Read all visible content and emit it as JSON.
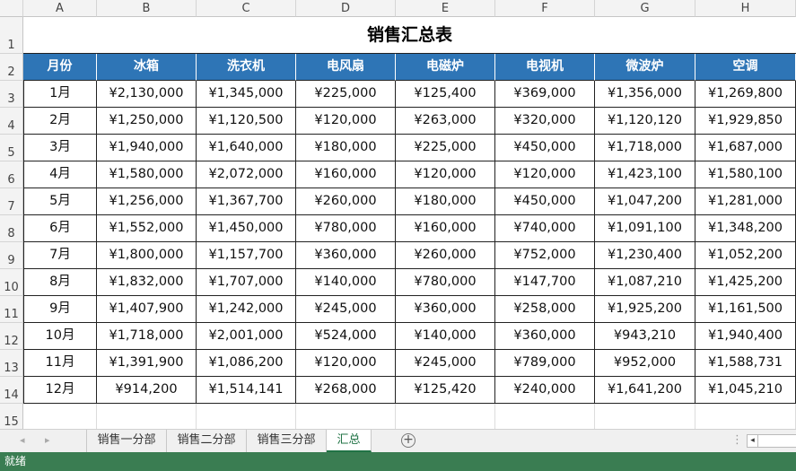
{
  "columns": [
    "A",
    "B",
    "C",
    "D",
    "E",
    "F",
    "G",
    "H"
  ],
  "rows": [
    "1",
    "2",
    "3",
    "4",
    "5",
    "6",
    "7",
    "8",
    "9",
    "10",
    "11",
    "12",
    "13",
    "14",
    "15"
  ],
  "title": "销售汇总表",
  "headers": [
    "月份",
    "冰箱",
    "洗衣机",
    "电风扇",
    "电磁炉",
    "电视机",
    "微波炉",
    "空调"
  ],
  "data": [
    [
      "1月",
      "¥2,130,000",
      "¥1,345,000",
      "¥225,000",
      "¥125,400",
      "¥369,000",
      "¥1,356,000",
      "¥1,269,800"
    ],
    [
      "2月",
      "¥1,250,000",
      "¥1,120,500",
      "¥120,000",
      "¥263,000",
      "¥320,000",
      "¥1,120,120",
      "¥1,929,850"
    ],
    [
      "3月",
      "¥1,940,000",
      "¥1,640,000",
      "¥180,000",
      "¥225,000",
      "¥450,000",
      "¥1,718,000",
      "¥1,687,000"
    ],
    [
      "4月",
      "¥1,580,000",
      "¥2,072,000",
      "¥160,000",
      "¥120,000",
      "¥120,000",
      "¥1,423,100",
      "¥1,580,100"
    ],
    [
      "5月",
      "¥1,256,000",
      "¥1,367,700",
      "¥260,000",
      "¥180,000",
      "¥450,000",
      "¥1,047,200",
      "¥1,281,000"
    ],
    [
      "6月",
      "¥1,552,000",
      "¥1,450,000",
      "¥780,000",
      "¥160,000",
      "¥740,000",
      "¥1,091,100",
      "¥1,348,200"
    ],
    [
      "7月",
      "¥1,800,000",
      "¥1,157,700",
      "¥360,000",
      "¥260,000",
      "¥752,000",
      "¥1,230,400",
      "¥1,052,200"
    ],
    [
      "8月",
      "¥1,832,000",
      "¥1,707,000",
      "¥140,000",
      "¥780,000",
      "¥147,700",
      "¥1,087,210",
      "¥1,425,200"
    ],
    [
      "9月",
      "¥1,407,900",
      "¥1,242,000",
      "¥245,000",
      "¥360,000",
      "¥258,000",
      "¥1,925,200",
      "¥1,161,500"
    ],
    [
      "10月",
      "¥1,718,000",
      "¥2,001,000",
      "¥524,000",
      "¥140,000",
      "¥360,000",
      "¥943,210",
      "¥1,940,400"
    ],
    [
      "11月",
      "¥1,391,900",
      "¥1,086,200",
      "¥120,000",
      "¥245,000",
      "¥789,000",
      "¥952,000",
      "¥1,588,731"
    ],
    [
      "12月",
      "¥914,200",
      "¥1,514,141",
      "¥268,000",
      "¥125,420",
      "¥240,000",
      "¥1,641,200",
      "¥1,045,210"
    ]
  ],
  "sheet_tabs": [
    "销售一分部",
    "销售二分部",
    "销售三分部",
    "汇总"
  ],
  "active_tab": "汇总",
  "add_sheet": "+",
  "status": "就绪",
  "colors": {
    "header_bg": "#2e75b6",
    "status_bg": "#3a7d52"
  }
}
